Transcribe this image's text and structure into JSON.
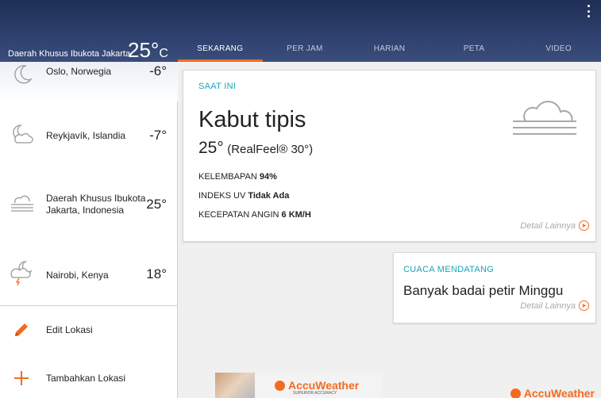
{
  "header": {
    "current_city": "Daerah Khusus Ibukota Jakarta",
    "current_temp": "25°",
    "current_unit": "C",
    "background_color": "#2d3f6c"
  },
  "tabs": [
    {
      "label": "SEKARANG",
      "active": true
    },
    {
      "label": "PER JAM",
      "active": false
    },
    {
      "label": "HARIAN",
      "active": false
    },
    {
      "label": "PETA",
      "active": false
    },
    {
      "label": "VIDEO",
      "active": false
    }
  ],
  "sidebar": {
    "locations": [
      {
        "name": "Oslo, Norwegia",
        "temp": "-6°",
        "icon": "moon-icon"
      },
      {
        "name": "Reykjavík, Islandia",
        "temp": "-7°",
        "icon": "moon-cloud-icon"
      },
      {
        "name": "Daerah Khusus Ibukota Jakarta, Indonesia",
        "temp": "25°",
        "icon": "fog-icon"
      },
      {
        "name": "Nairobi, Kenya",
        "temp": "18°",
        "icon": "moon-thunderstorm-icon"
      }
    ],
    "actions": [
      {
        "label": "Edit Lokasi",
        "icon": "pencil-icon"
      },
      {
        "label": "Tambahkan Lokasi",
        "icon": "plus-icon"
      }
    ]
  },
  "current": {
    "section_label": "SAAT INI",
    "condition": "Kabut tipis",
    "temp": "25°",
    "realfeel": "(RealFeel® 30°)",
    "humidity_label": "KELEMBAPAN",
    "humidity_value": "94%",
    "uv_label": "INDEKS UV",
    "uv_value": "Tidak Ada",
    "wind_label": "KECEPATAN ANGIN",
    "wind_value": "6 KM/H",
    "more_label": "Detail Lainnya",
    "icon": "fog-icon"
  },
  "upcoming": {
    "section_label": "CUACA MENDATANG",
    "text": "Banyak badai petir Minggu",
    "more_label": "Detail Lainnya"
  },
  "ad": {
    "brand": "AccuWeather",
    "tagline": "SUPERIOR ACCURACY"
  },
  "footer_brand": "AccuWeather",
  "colors": {
    "accent": "#f36b21",
    "label_teal": "#19a4b8"
  }
}
